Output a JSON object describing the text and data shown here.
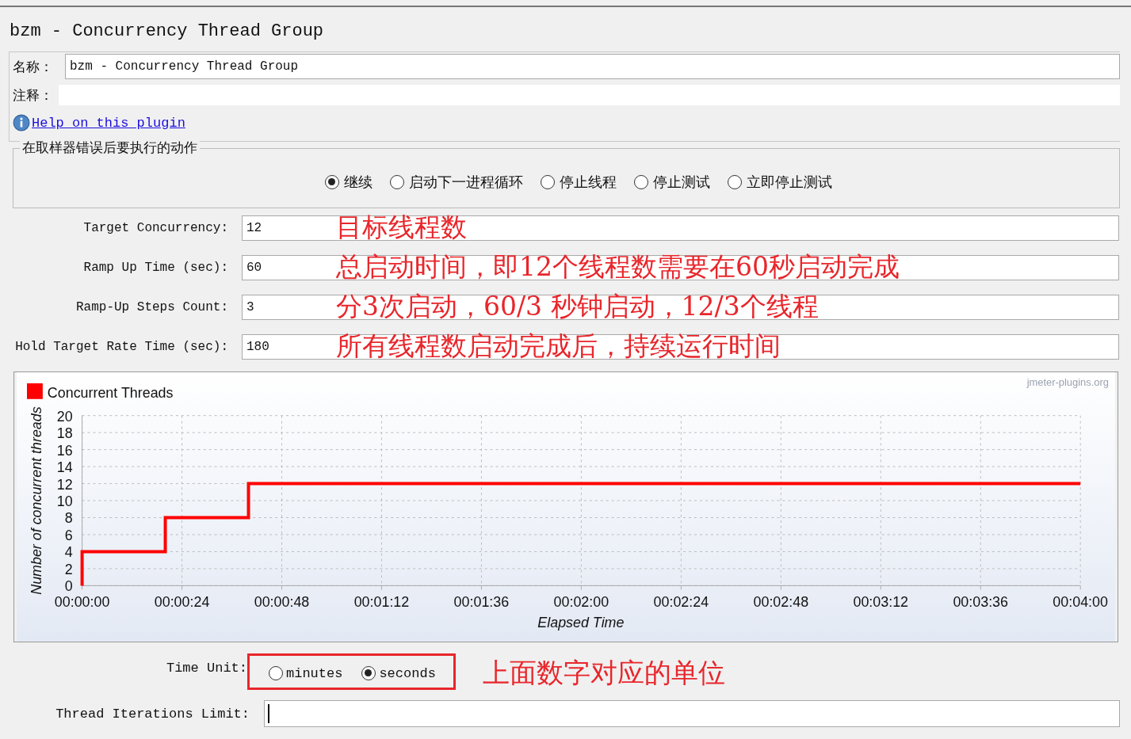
{
  "title": "bzm - Concurrency Thread Group",
  "name_field": {
    "label": "名称：",
    "value": "bzm - Concurrency Thread Group"
  },
  "comment_field": {
    "label": "注释："
  },
  "help_link": "Help on this plugin",
  "error_action": {
    "legend": "在取样器错误后要执行的动作",
    "options": [
      {
        "label": "继续",
        "selected": true
      },
      {
        "label": "启动下一进程循环",
        "selected": false
      },
      {
        "label": "停止线程",
        "selected": false
      },
      {
        "label": "停止测试",
        "selected": false
      },
      {
        "label": "立即停止测试",
        "selected": false
      }
    ]
  },
  "parameters": [
    {
      "label": "Target Concurrency:",
      "value": "12",
      "annotation": "目标线程数"
    },
    {
      "label": "Ramp Up Time (sec):",
      "value": "60",
      "annotation": "总启动时间，即12个线程数需要在60秒启动完成"
    },
    {
      "label": "Ramp-Up Steps Count:",
      "value": "3",
      "annotation": "分3次启动，60/3 秒钟启动，12/3个线程"
    },
    {
      "label": "Hold Target Rate Time (sec):",
      "value": "180",
      "annotation": "所有线程数启动完成后，持续运行时间"
    }
  ],
  "chart": {
    "watermark": "jmeter-plugins.org",
    "chart_data": {
      "type": "line",
      "grid": true,
      "xlabel": "Elapsed Time",
      "ylabel": "Number of concurrent threads",
      "x": [
        0,
        0,
        20,
        20,
        40,
        40,
        240
      ],
      "series": [
        {
          "name": "Concurrent Threads",
          "color": "#ff0000",
          "values": [
            0,
            4,
            4,
            8,
            8,
            12,
            12
          ]
        }
      ],
      "xlim": [
        0,
        240
      ],
      "ylim": [
        0,
        20
      ],
      "xticks": [
        {
          "value": 0,
          "label": "00:00:00"
        },
        {
          "value": 24,
          "label": "00:00:24"
        },
        {
          "value": 48,
          "label": "00:00:48"
        },
        {
          "value": 72,
          "label": "00:01:12"
        },
        {
          "value": 96,
          "label": "00:01:36"
        },
        {
          "value": 120,
          "label": "00:02:00"
        },
        {
          "value": 144,
          "label": "00:02:24"
        },
        {
          "value": 168,
          "label": "00:02:48"
        },
        {
          "value": 192,
          "label": "00:03:12"
        },
        {
          "value": 216,
          "label": "00:03:36"
        },
        {
          "value": 240,
          "label": "00:04:00"
        }
      ],
      "yticks": [
        0,
        2,
        4,
        6,
        8,
        10,
        12,
        14,
        16,
        18,
        20
      ]
    }
  },
  "time_unit": {
    "label": "Time Unit:",
    "options": [
      {
        "label": "minutes",
        "selected": false
      },
      {
        "label": "seconds",
        "selected": true
      }
    ],
    "annotation": "上面数字对应的单位"
  },
  "iterations": {
    "label": "Thread Iterations Limit:"
  }
}
